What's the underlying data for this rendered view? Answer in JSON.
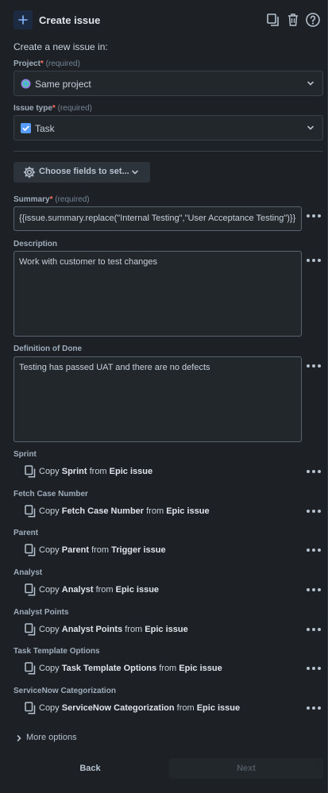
{
  "header": {
    "title": "Create issue",
    "icons": [
      "plus-icon",
      "copy-icon",
      "trash-icon",
      "help-icon"
    ]
  },
  "intro": "Create a new issue in:",
  "project": {
    "label": "Project",
    "required_star": "*",
    "required_text": "(required)",
    "value": "Same project",
    "icon": "project-avatar-icon"
  },
  "issue_type": {
    "label": "Issue type",
    "required_star": "*",
    "required_text": "(required)",
    "value": "Task",
    "icon": "task-checkbox-icon"
  },
  "choose_fields": {
    "label": "Choose fields to set..."
  },
  "summary": {
    "label": "Summary",
    "required_star": "*",
    "required_text": "(required)",
    "value": "{{issue.summary.replace(\"Internal Testing\",\"User Acceptance Testing\")}}"
  },
  "description": {
    "label": "Description",
    "value": "Work with customer to test changes"
  },
  "definition_of_done": {
    "label": "Definition of Done",
    "value": "Testing has passed UAT and there are no defects"
  },
  "copy_fields": [
    {
      "label": "Sprint",
      "prefix": "Copy",
      "field": "Sprint",
      "from": "from",
      "source": "Epic issue"
    },
    {
      "label": "Fetch Case Number",
      "prefix": "Copy",
      "field": "Fetch Case Number",
      "from": "from",
      "source": "Epic issue"
    },
    {
      "label": "Parent",
      "prefix": "Copy",
      "field": "Parent",
      "from": "from",
      "source": "Trigger issue"
    },
    {
      "label": "Analyst",
      "prefix": "Copy",
      "field": "Analyst",
      "from": "from",
      "source": "Epic issue"
    },
    {
      "label": "Analyst Points",
      "prefix": "Copy",
      "field": "Analyst Points",
      "from": "from",
      "source": "Epic issue"
    },
    {
      "label": "Task Template Options",
      "prefix": "Copy",
      "field": "Task Template Options",
      "from": "from",
      "source": "Epic issue"
    },
    {
      "label": "ServiceNow Categorization",
      "prefix": "Copy",
      "field": "ServiceNow Categorization",
      "from": "from",
      "source": "Epic issue"
    }
  ],
  "more_options": {
    "label": "More options"
  },
  "footer": {
    "back": "Back",
    "next": "Next"
  },
  "colors": {
    "background": "#1d2125",
    "input_background": "#22272b",
    "required": "#f87168",
    "task_blue": "#579dff"
  }
}
